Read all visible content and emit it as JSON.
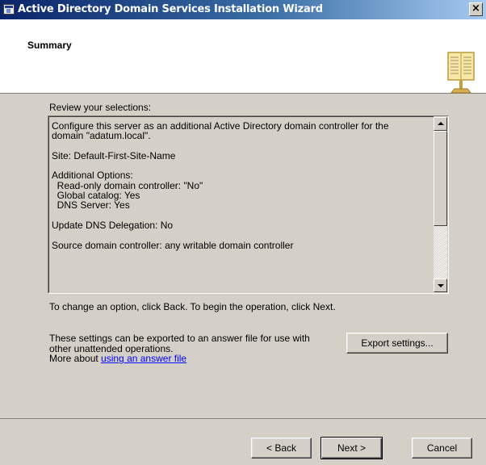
{
  "window": {
    "title": "Active Directory Domain Services Installation Wizard",
    "close_label": "×"
  },
  "header": {
    "title": "Summary",
    "icon": "book-icon"
  },
  "content": {
    "review_label": "Review your selections:",
    "summary_lines": "Configure this server as an additional Active Directory domain controller for the\ndomain \"adatum.local\".\n\nSite: Default-First-Site-Name\n\nAdditional Options:\n  Read-only domain controller: \"No\"\n  Global catalog: Yes\n  DNS Server: Yes\n\nUpdate DNS Delegation: No\n\nSource domain controller: any writable domain controller",
    "change_hint": "To change an option, click Back. To begin the operation, click Next.",
    "export_line1": "These settings can be exported to an answer file for use with",
    "export_line2": "other unattended operations.",
    "export_line3_prefix": "More about ",
    "export_link": "using an answer file",
    "export_button": "Export settings..."
  },
  "footer": {
    "back_label": "< Back",
    "next_label": "Next >",
    "cancel_label": "Cancel"
  },
  "colors": {
    "title_gradient_start": "#0a246a",
    "dialog_face": "#d4d0c8",
    "link": "#0000ff"
  }
}
